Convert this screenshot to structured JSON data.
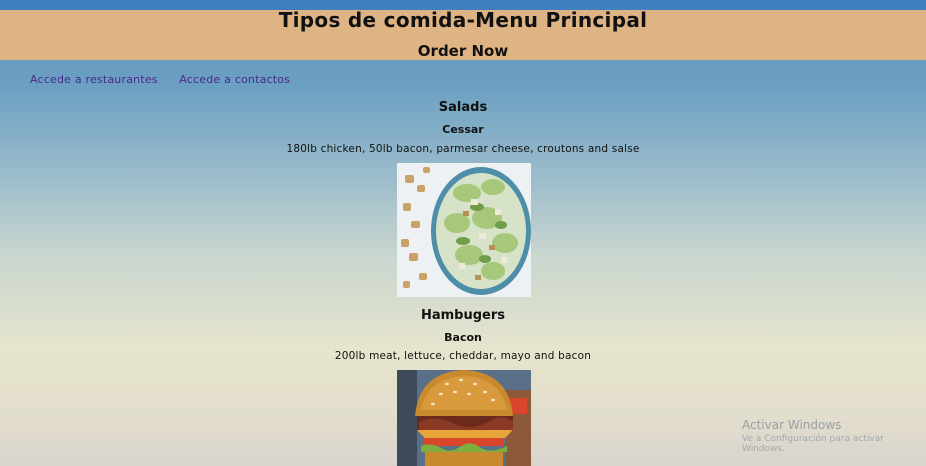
{
  "header": {
    "title": "Tipos de comida-Menu Principal",
    "subtitle": "Order Now"
  },
  "nav": {
    "links": [
      "Accede a restaurantes",
      "Accede a contactos"
    ]
  },
  "menu": {
    "sections": [
      {
        "title": "Salads",
        "item_name": "Cessar",
        "description": "180lb chicken, 50lb bacon, parmesar cheese, croutons and salse",
        "image_icon": "salad-photo"
      },
      {
        "title": "Hambugers",
        "item_name": "Bacon",
        "description": "200lb meat, lettuce, cheddar, mayo and bacon",
        "image_icon": "burger-photo"
      }
    ]
  },
  "watermark": {
    "line1": "Activar Windows",
    "line2": "Ve a Configuración para activar Windows."
  },
  "colors": {
    "header_bg": "#deb485",
    "top_strip": "#3f7fbf",
    "link": "#4a2a8a"
  }
}
